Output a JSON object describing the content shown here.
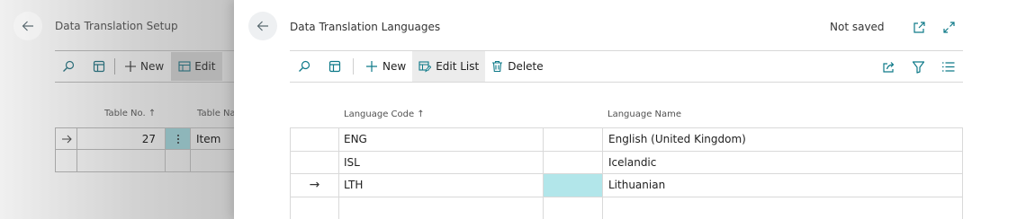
{
  "background_page": {
    "title": "Data Translation Setup",
    "toolbar": {
      "new_label": "New",
      "edit_list_label": "Edit"
    },
    "columns": {
      "table_no": "Table No. ↑",
      "table_name": "Table Na"
    },
    "rows": [
      {
        "table_no": "27",
        "table_name": "Item"
      }
    ]
  },
  "panel": {
    "title": "Data Translation Languages",
    "status": "Not saved",
    "toolbar": {
      "new_label": "New",
      "edit_list_label": "Edit List",
      "delete_label": "Delete"
    },
    "columns": {
      "language_code": "Language Code ↑",
      "language_name": "Language Name"
    },
    "rows": [
      {
        "language_code": "ENG",
        "language_name": "English (United Kingdom)"
      },
      {
        "language_code": "ISL",
        "language_name": "Icelandic"
      },
      {
        "language_code": "LTH",
        "language_name": "Lithuanian"
      }
    ],
    "current_row_indicator": "→"
  },
  "colors": {
    "accent": "#0f7a89",
    "selected_cell": "#b2e6ea",
    "active_button": "#ececec"
  }
}
